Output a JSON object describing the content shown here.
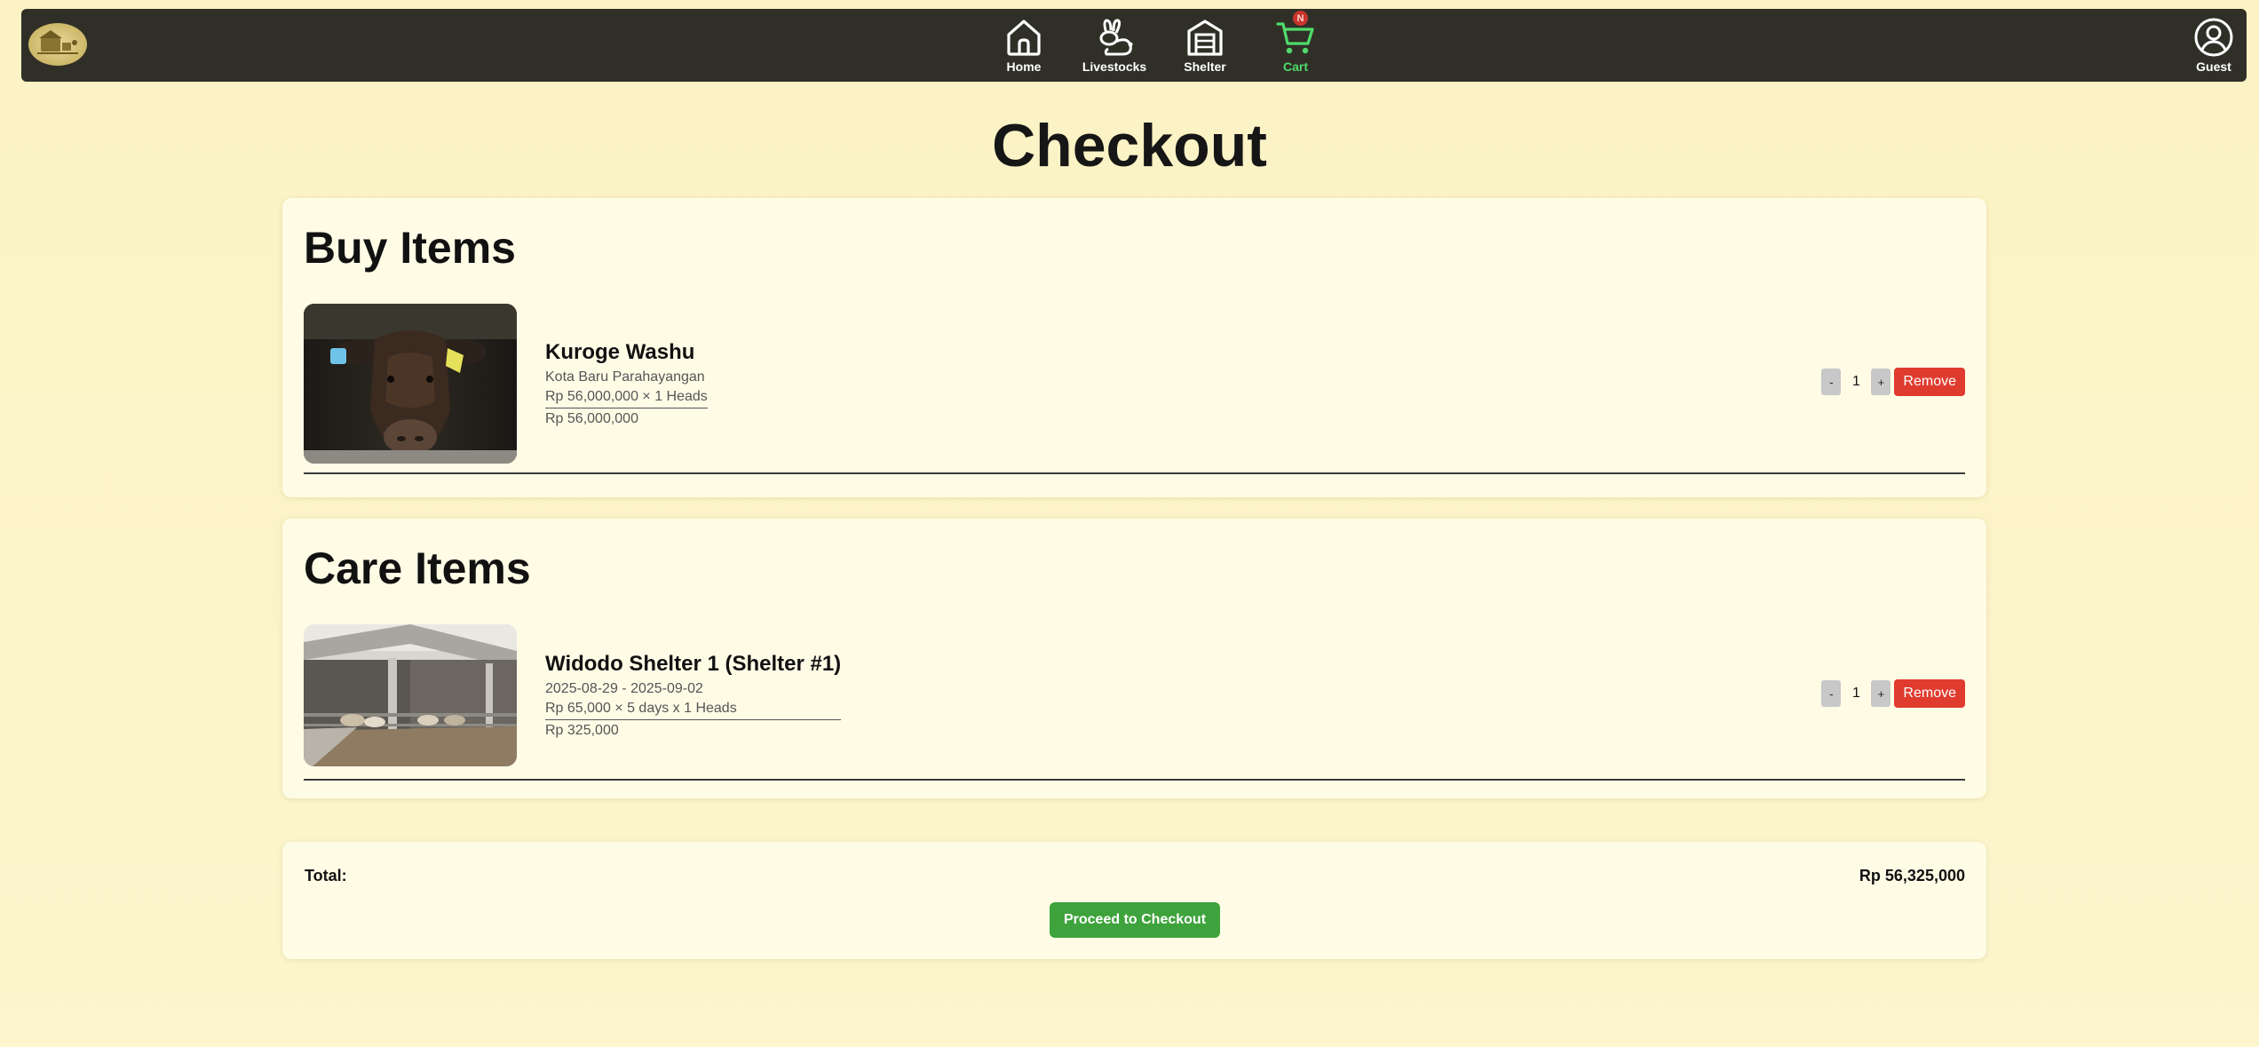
{
  "nav": {
    "items": [
      {
        "label": "Home",
        "icon": "home-icon"
      },
      {
        "label": "Livestocks",
        "icon": "rabbit-icon"
      },
      {
        "label": "Shelter",
        "icon": "warehouse-icon"
      },
      {
        "label": "Cart",
        "icon": "cart-icon",
        "active": true
      }
    ],
    "cart_badge": "N",
    "account_label": "Guest",
    "account_icon": "user-circle-icon",
    "active_color": "#4fdc6a"
  },
  "page": {
    "title": "Checkout"
  },
  "buy": {
    "heading": "Buy Items",
    "items": [
      {
        "name": "Kuroge Washu",
        "location": "Kota Baru Parahayangan",
        "calc": "Rp 56,000,000 × 1 Heads",
        "subtotal": "Rp 56,000,000",
        "qty": "1",
        "minus": "-",
        "plus": "+",
        "remove": "Remove"
      }
    ]
  },
  "care": {
    "heading": "Care Items",
    "items": [
      {
        "name": "Widodo Shelter 1 (Shelter #1)",
        "dates": "2025-08-29 - 2025-09-02",
        "calc": "Rp 65,000 × 5 days x 1 Heads",
        "subtotal": "Rp 325,000",
        "qty": "1",
        "minus": "-",
        "plus": "+",
        "remove": "Remove"
      }
    ]
  },
  "summary": {
    "total_label": "Total:",
    "total_value": "Rp 56,325,000",
    "checkout_label": "Proceed to Checkout"
  },
  "colors": {
    "background": "#fbf3c4",
    "navbar": "#302f27",
    "card": "#fffce6",
    "remove": "#e03b2f",
    "checkout": "#3ea33c"
  }
}
